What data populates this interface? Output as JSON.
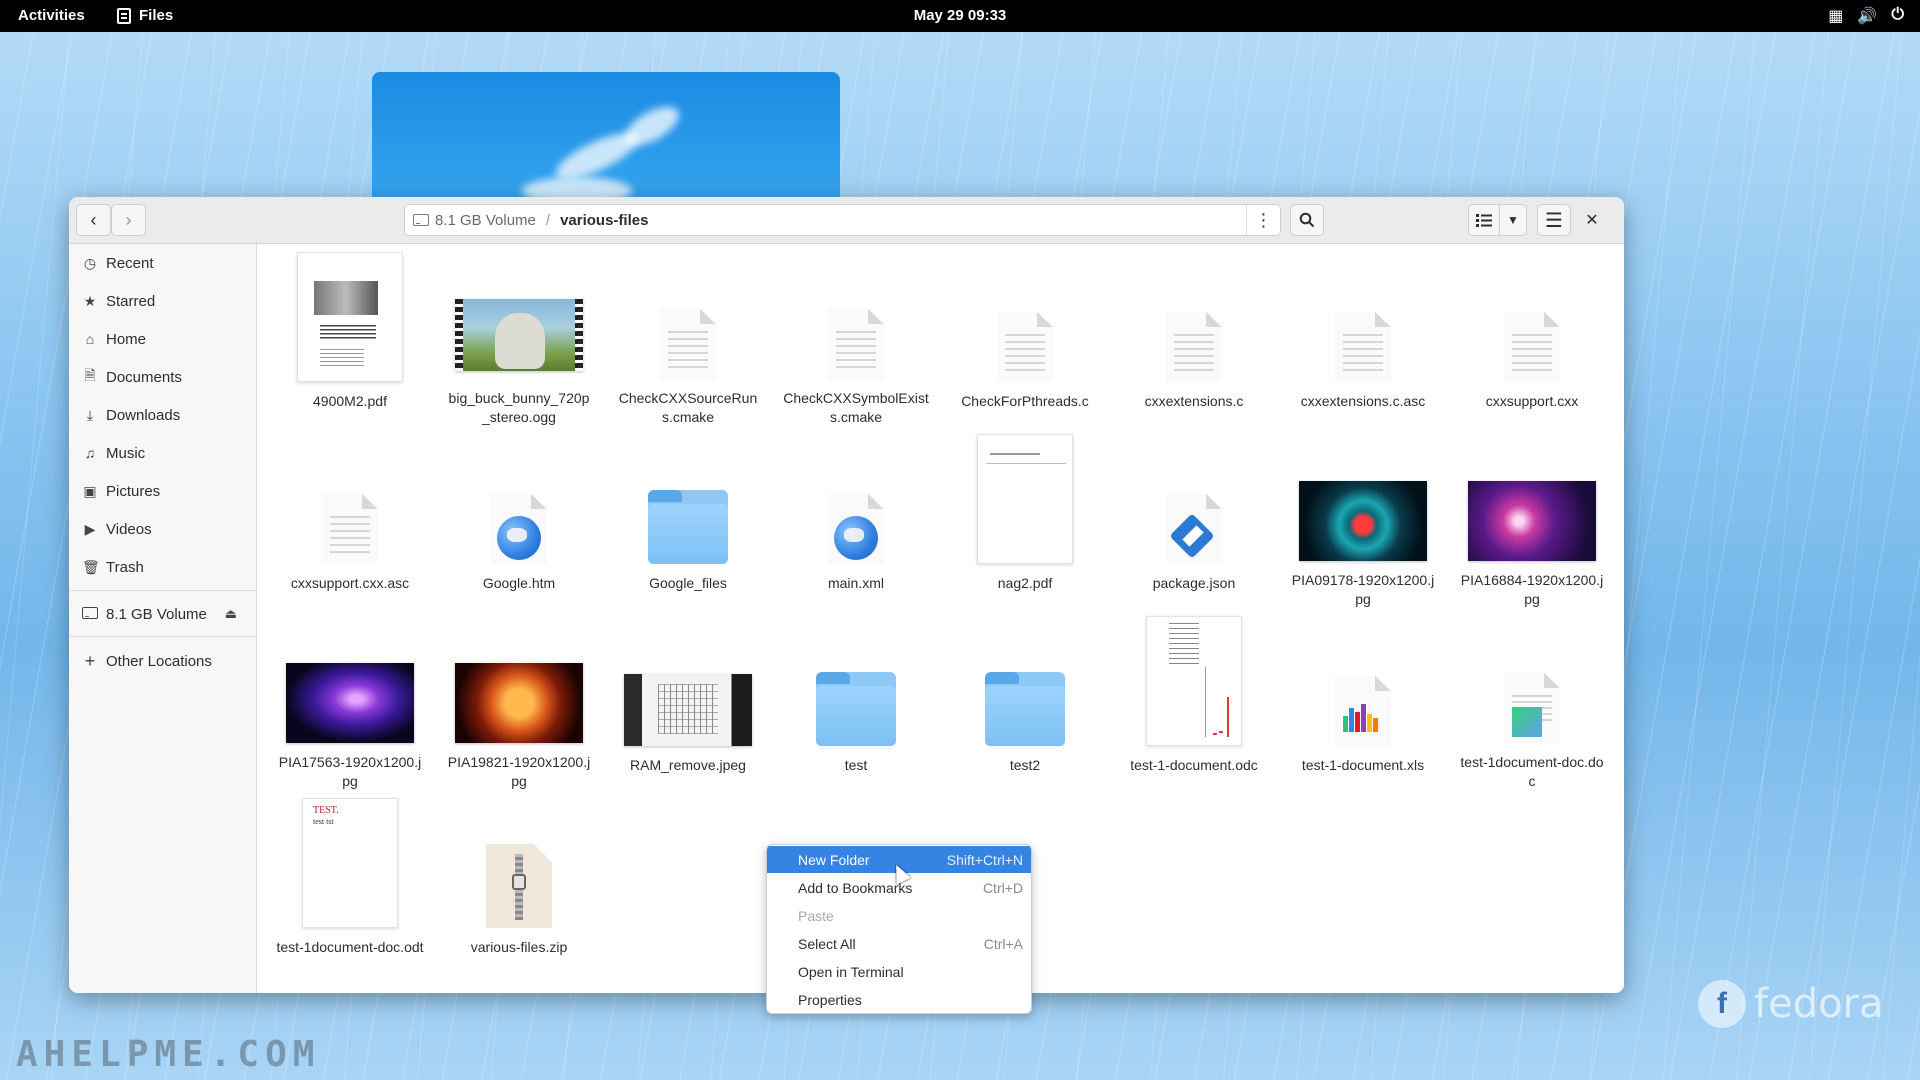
{
  "topbar": {
    "activities": "Activities",
    "app_name": "Files",
    "clock": "May 29  09:33",
    "tray": {
      "network": "network-icon",
      "volume": "volume-icon",
      "power": "power-icon"
    }
  },
  "headerbar": {
    "back_icon": "chevron-left-icon",
    "forward_icon": "chevron-right-icon",
    "path": {
      "volume": "8.1 GB Volume",
      "separator": "/",
      "folder": "various-files"
    },
    "menu_icon": "vertical-dots-icon",
    "close_icon": "close-icon"
  },
  "sidebar": {
    "items": [
      {
        "label": "Recent",
        "icon": "clock-icon"
      },
      {
        "label": "Starred",
        "icon": "star-icon"
      },
      {
        "label": "Home",
        "icon": "home-icon"
      },
      {
        "label": "Documents",
        "icon": "document-icon"
      },
      {
        "label": "Downloads",
        "icon": "download-icon"
      },
      {
        "label": "Music",
        "icon": "music-icon"
      },
      {
        "label": "Pictures",
        "icon": "picture-icon"
      },
      {
        "label": "Videos",
        "icon": "video-icon"
      },
      {
        "label": "Trash",
        "icon": "trash-icon"
      }
    ],
    "volume": {
      "label": "8.1 GB Volume",
      "icon": "drive-icon",
      "eject_icon": "eject-icon"
    },
    "other": {
      "label": "Other Locations",
      "icon": "plus-icon"
    }
  },
  "files": [
    {
      "name": "4900M2.pdf",
      "kind": "pdf-thumb"
    },
    {
      "name": "big_buck_bunny_720p_stereo.ogg",
      "kind": "video-thumb"
    },
    {
      "name": "CheckCXXSourceRuns.cmake",
      "kind": "text"
    },
    {
      "name": "CheckCXXSymbolExists.cmake",
      "kind": "text"
    },
    {
      "name": "CheckForPthreads.c",
      "kind": "text"
    },
    {
      "name": "cxxextensions.c",
      "kind": "text"
    },
    {
      "name": "cxxextensions.c.asc",
      "kind": "text"
    },
    {
      "name": "cxxsupport.cxx",
      "kind": "text"
    },
    {
      "name": "cxxsupport.cxx.asc",
      "kind": "text"
    },
    {
      "name": "Google.htm",
      "kind": "html"
    },
    {
      "name": "Google_files",
      "kind": "folder"
    },
    {
      "name": "main.xml",
      "kind": "html"
    },
    {
      "name": "nag2.pdf",
      "kind": "pdf-blank"
    },
    {
      "name": "package.json",
      "kind": "json"
    },
    {
      "name": "PIA09178-1920x1200.jpg",
      "kind": "photo-helix"
    },
    {
      "name": "PIA16884-1920x1200.jpg",
      "kind": "photo-nebula"
    },
    {
      "name": "PIA17563-1920x1200.jpg",
      "kind": "photo-purple"
    },
    {
      "name": "PIA19821-1920x1200.jpg",
      "kind": "photo-sun"
    },
    {
      "name": "RAM_remove.jpeg",
      "kind": "photo-ram"
    },
    {
      "name": "test",
      "kind": "folder"
    },
    {
      "name": "test2",
      "kind": "folder"
    },
    {
      "name": "test-1-document.odc",
      "kind": "odc"
    },
    {
      "name": "test-1-document.xls",
      "kind": "xls"
    },
    {
      "name": "test-1document-doc.doc",
      "kind": "doc"
    },
    {
      "name": "test-1document-doc.odt",
      "kind": "odt"
    },
    {
      "name": "various-files.zip",
      "kind": "zip"
    }
  ],
  "odt_thumb_text": {
    "line1": "TEST.",
    "line2": "test tst"
  },
  "context_menu": [
    {
      "label": "New Folder",
      "accel": "Shift+Ctrl+N",
      "state": "active"
    },
    {
      "label": "Add to Bookmarks",
      "accel": "Ctrl+D",
      "state": "normal"
    },
    {
      "label": "Paste",
      "accel": "",
      "state": "disabled"
    },
    {
      "label": "Select All",
      "accel": "Ctrl+A",
      "state": "normal"
    },
    {
      "label": "Open in Terminal",
      "accel": "",
      "state": "normal"
    },
    {
      "label": "Properties",
      "accel": "",
      "state": "normal"
    }
  ],
  "desktop": {
    "watermark": "AHELPME.COM",
    "brand": "fedora"
  },
  "colors": {
    "accent": "#3584e4",
    "folder": "#8ec9f5",
    "topbar": "#000000"
  }
}
